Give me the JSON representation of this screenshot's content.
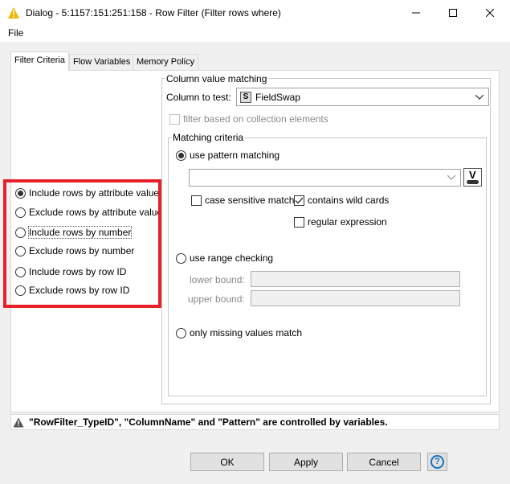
{
  "window": {
    "title": "Dialog - 5:1157:151:251:158 - Row Filter (Filter rows where)"
  },
  "menu": {
    "file": "File"
  },
  "tabs": [
    {
      "label": "Filter Criteria",
      "selected": true
    },
    {
      "label": "Flow Variables",
      "selected": false
    },
    {
      "label": "Memory Policy",
      "selected": false
    }
  ],
  "filter_options": [
    {
      "label": "Include rows by attribute value",
      "selected": true
    },
    {
      "label": "Exclude rows by attribute value",
      "selected": false
    },
    {
      "label": "Include rows by number",
      "selected": false
    },
    {
      "label": "Exclude rows by number",
      "selected": false
    },
    {
      "label": "Include rows by row ID",
      "selected": false
    },
    {
      "label": "Exclude rows by row ID",
      "selected": false
    }
  ],
  "column_matching": {
    "legend": "Column value matching",
    "column_label": "Column to test:",
    "column_type_badge": "S",
    "column_value": "FieldSwap",
    "collection_label": "filter based on collection elements"
  },
  "matching_criteria": {
    "legend": "Matching criteria",
    "pattern_label": "use pattern matching",
    "pattern_value": "",
    "flow_var_badge": "V",
    "case_sensitive": "case sensitive match",
    "wild_cards": "contains wild cards",
    "regex": "regular expression",
    "range_label": "use range checking",
    "lower_bound": "lower bound:",
    "upper_bound": "upper bound:",
    "missing_label": "only missing values match"
  },
  "status_message": "\"RowFilter_TypeID\", \"ColumnName\" and \"Pattern\" are controlled by variables.",
  "buttons": {
    "ok": "OK",
    "apply": "Apply",
    "cancel": "Cancel",
    "help": "?"
  },
  "colors": {
    "highlight_border": "#e8202a",
    "title_icon": "#f5b400"
  }
}
